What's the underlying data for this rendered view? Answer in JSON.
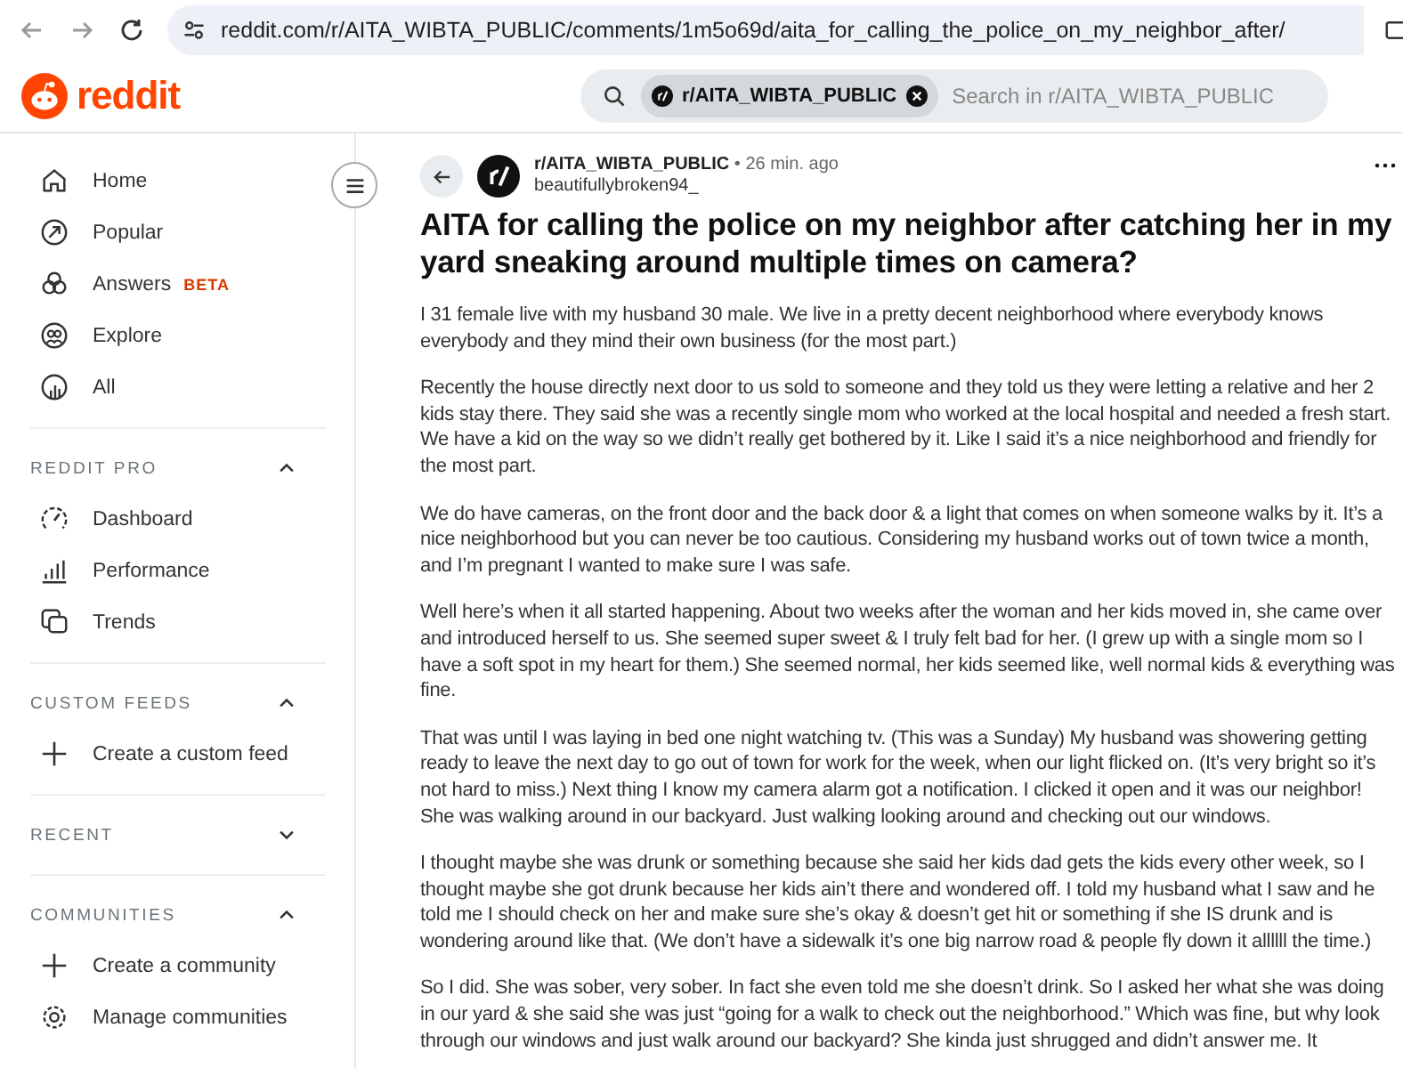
{
  "browser": {
    "url": "reddit.com/r/AITA_WIBTA_PUBLIC/comments/1m5o69d/aita_for_calling_the_police_on_my_neighbor_after/"
  },
  "header": {
    "logo": "reddit",
    "search": {
      "chip": "r/AITA_WIBTA_PUBLIC",
      "placeholder": "Search in r/AITA_WIBTA_PUBLIC"
    }
  },
  "sidebar": {
    "items": [
      {
        "label": "Home"
      },
      {
        "label": "Popular"
      },
      {
        "label": "Answers",
        "badge": "BETA"
      },
      {
        "label": "Explore"
      },
      {
        "label": "All"
      }
    ],
    "sections": [
      {
        "title": "REDDIT PRO",
        "expanded": true,
        "items": [
          {
            "label": "Dashboard"
          },
          {
            "label": "Performance"
          },
          {
            "label": "Trends"
          }
        ]
      },
      {
        "title": "CUSTOM FEEDS",
        "expanded": true,
        "items": [
          {
            "label": "Create a custom feed"
          }
        ]
      },
      {
        "title": "RECENT",
        "expanded": false
      },
      {
        "title": "COMMUNITIES",
        "expanded": true,
        "items": [
          {
            "label": "Create a community"
          },
          {
            "label": "Manage communities"
          }
        ]
      }
    ]
  },
  "post": {
    "subreddit": "r/AITA_WIBTA_PUBLIC",
    "time": "• 26 min. ago",
    "author": "beautifullybroken94_",
    "title": "AITA for calling the police on my neighbor after catching her in my yard sneaking around multiple times on camera?",
    "paragraphs": [
      "I 31 female live with my husband 30 male. We live in a pretty decent neighborhood where everybody knows everybody and they mind their own business (for the most part.)",
      "Recently the house directly next door to us sold to someone and they told us they were letting a relative and her 2 kids stay there. They said she was a recently single mom who worked at the local hospital and needed a fresh start. We have a kid on the way so we didn’t really get bothered by it. Like I said it’s a nice neighborhood and friendly for the most part.",
      "We do have cameras, on the front door and the back door & a light that comes on when someone walks by it. It’s a nice neighborhood but you can never be too cautious. Considering my husband works out of town twice a month, and I’m pregnant I wanted to make sure I was safe.",
      "Well here’s when it all started happening. About two weeks after the woman and her kids moved in, she came over and introduced herself to us. She seemed super sweet & I truly felt bad for her. (I grew up with a single mom so I have a soft spot in my heart for them.) She seemed normal, her kids seemed like, well normal kids & everything was fine.",
      "That was until I was laying in bed one night watching tv. (This was a Sunday) My husband was showering getting ready to leave the next day to go out of town for work for the week, when our light flicked on. (It’s very bright so it’s not hard to miss.) Next thing I know my camera alarm got a notification. I clicked it open and it was our neighbor! She was walking around in our backyard. Just walking looking around and checking out our windows.",
      "I thought maybe she was drunk or something because she said her kids dad gets the kids every other week, so I thought maybe she got drunk because her kids ain’t there and wondered off. I told my husband what I saw and he told me I should check on her and make sure she’s okay & doesn’t get hit or something if she IS drunk and is wondering around like that. (We don’t have a sidewalk it’s one big narrow road & people fly down it allllll the time.)",
      "So I did. She was sober, very sober. In fact she even told me she doesn’t drink. So I asked her what she was doing in our yard & she said she was just “going for a walk to check out the neighborhood.” Which was fine, but why look through our windows and just walk around our backyard? She kinda just shrugged and didn’t answer me. It"
    ]
  }
}
